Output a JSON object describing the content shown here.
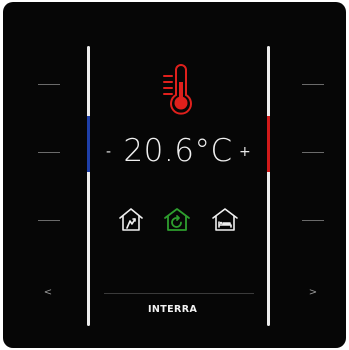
{
  "temperature": {
    "value": "20.6",
    "unit": "°C",
    "decrease_label": "-",
    "increase_label": "+"
  },
  "icons": {
    "thermometer": "thermometer-icon",
    "mode_left": "home-away-icon",
    "mode_center": "home-auto-icon",
    "mode_right": "home-sleep-icon"
  },
  "nav": {
    "prev_label": "<",
    "next_label": ">"
  },
  "brand": {
    "name": "INTERRA"
  },
  "colors": {
    "background": "#060606",
    "cold_accent": "#1e3fa8",
    "hot_accent": "#d11a1a",
    "thermometer": "#e0201c",
    "active_mode": "#2e9e2e",
    "text": "#f0f0f0"
  },
  "active_mode": "auto"
}
